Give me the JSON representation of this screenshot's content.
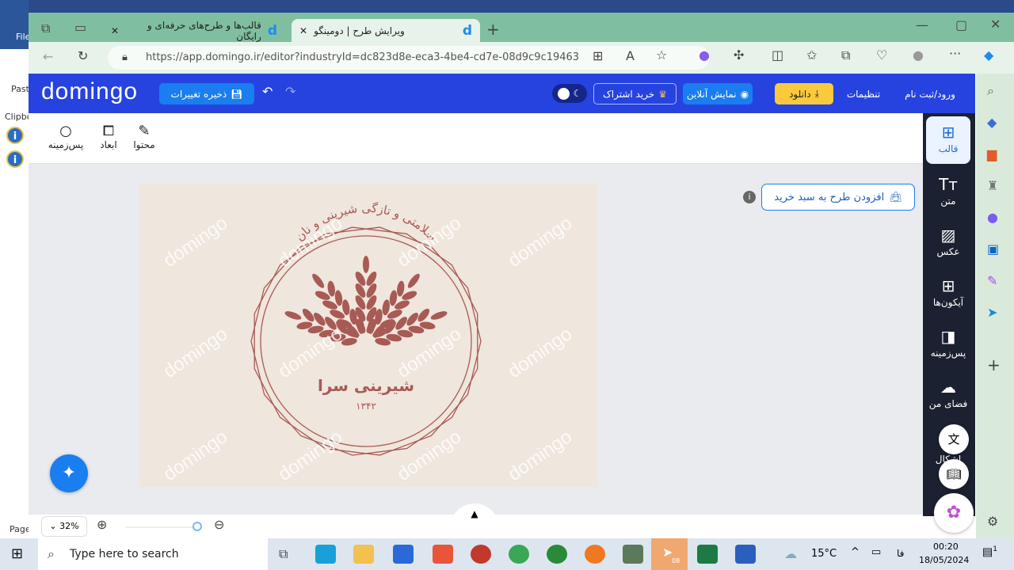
{
  "desktop": {
    "file_label": "File",
    "paste_label": "Paste",
    "clipboard_label": "Clipbo",
    "page_label": "Page"
  },
  "browser": {
    "tabs": [
      {
        "title": "قالب‌ها و طرح‌های حرفه‌ای و رایگان",
        "active": false
      },
      {
        "title": "ویرایش طرح | دومینگو",
        "active": true
      }
    ],
    "url": "https://app.domingo.ir/editor?industryId=dc823d8e-eca3-4be4-cd7e-08d9c9c19463"
  },
  "header": {
    "logo": "domingo",
    "save_label": "ذخیره تغییرات",
    "subscribe_label": "خرید اشتراک",
    "preview_label": "نمایش آنلاین",
    "download_label": "دانلود",
    "settings_label": "تنظیمات",
    "login_label": "ورود/ثبت نام",
    "accent": "#2643e0"
  },
  "toolbar": {
    "items": [
      {
        "label": "محتوا",
        "icon": "pencil-icon"
      },
      {
        "label": "ابعاد",
        "icon": "resize-icon"
      },
      {
        "label": "پس‌زمینه",
        "icon": "circle-icon"
      }
    ]
  },
  "workspace": {
    "add_to_cart_label": "افزودن طرح به سبد خرید"
  },
  "design": {
    "arc_text": "سلامتی و تازگی شیرینی و نان",
    "title": "شیرینی سرا",
    "year": "۱۳۴۲",
    "watermark": "domingo",
    "color": "#a85a55",
    "background": "#efe6dd"
  },
  "sidebar": {
    "items": [
      {
        "label": "قالب",
        "icon": "layout-icon",
        "active": true
      },
      {
        "label": "متن",
        "icon": "text-icon"
      },
      {
        "label": "عکس",
        "icon": "image-icon"
      },
      {
        "label": "آیکون‌ها",
        "icon": "grid-icon"
      },
      {
        "label": "پس‌زمینه",
        "icon": "background-icon"
      },
      {
        "label": "فضای من",
        "icon": "cloud-upload-icon"
      },
      {
        "label": "اشکال",
        "icon": "shapes-icon"
      }
    ]
  },
  "bottom": {
    "zoom": "32%"
  },
  "taskbar": {
    "search_placeholder": "Type here to search",
    "weather": "15°C",
    "lang": "فا",
    "time": "00:20",
    "date": "18/05/2024",
    "telegram_badge": "08",
    "notif_count": "1"
  }
}
